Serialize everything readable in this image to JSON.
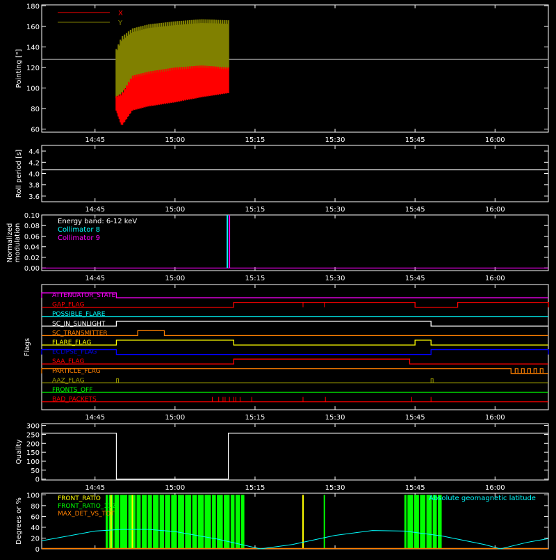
{
  "colors": {
    "background": "#000000",
    "axis": "#ffffff",
    "red": "#ff0000",
    "olive": "#808000",
    "cyan": "#00ffff",
    "magenta": "#ff00ff",
    "orange": "#ff8000",
    "yellow": "#ffff00",
    "blue": "#0000ff",
    "green": "#00ff00",
    "olive_flag": "#9a9a00"
  },
  "time_axis": {
    "start": "14:35",
    "end": "16:10",
    "ticks": [
      "14:45",
      "15:00",
      "15:15",
      "15:30",
      "15:45",
      "16:00"
    ]
  },
  "chart_data": [
    {
      "id": "pointing",
      "type": "line",
      "ylabel": "Pointing [\"]",
      "ylim": [
        57,
        181
      ],
      "yticks": [
        "60",
        "80",
        "100",
        "120",
        "140",
        "160",
        "180"
      ],
      "xlim": [
        "14:35",
        "16:10"
      ],
      "legend": [
        "X",
        "Y"
      ],
      "legend_position": "top-left",
      "reference_line": 128,
      "series": [
        {
          "name": "X",
          "color_key": "red",
          "band": [
            {
              "t": "14:49",
              "low": 78,
              "high": 92
            },
            {
              "t": "14:50",
              "low": 63,
              "high": 95
            },
            {
              "t": "14:52",
              "low": 78,
              "high": 112
            },
            {
              "t": "14:55",
              "low": 82,
              "high": 116
            },
            {
              "t": "15:00",
              "low": 86,
              "high": 120
            },
            {
              "t": "15:05",
              "low": 91,
              "high": 122
            },
            {
              "t": "15:10",
              "low": 95,
              "high": 120
            }
          ]
        },
        {
          "name": "Y",
          "color_key": "olive",
          "band": [
            {
              "t": "14:49",
              "low": 90,
              "high": 138
            },
            {
              "t": "14:50",
              "low": 95,
              "high": 150
            },
            {
              "t": "14:52",
              "low": 105,
              "high": 158
            },
            {
              "t": "14:55",
              "low": 110,
              "high": 162
            },
            {
              "t": "15:00",
              "low": 112,
              "high": 165
            },
            {
              "t": "15:05",
              "low": 115,
              "high": 167
            },
            {
              "t": "15:10",
              "low": 117,
              "high": 166
            }
          ]
        }
      ]
    },
    {
      "id": "roll_period",
      "type": "line",
      "ylabel": "Roll period [s]",
      "ylim": [
        3.5,
        4.5
      ],
      "yticks": [
        "3.6",
        "3.8",
        "4.0",
        "4.2",
        "4.4"
      ],
      "xlim": [
        "14:35",
        "16:10"
      ],
      "series": [
        {
          "color_key": "axis",
          "points": [
            {
              "t": "14:35",
              "v": 4.07
            },
            {
              "t": "16:10",
              "v": 4.07
            }
          ]
        }
      ]
    },
    {
      "id": "modulation",
      "type": "line",
      "ylabel": "Normalized modulation",
      "ylim": [
        -0.005,
        0.1
      ],
      "yticks": [
        "0.00",
        "0.02",
        "0.04",
        "0.06",
        "0.08",
        "0.10"
      ],
      "xlim": [
        "14:35",
        "16:10"
      ],
      "annotation": "Energy band: 6-12 keV",
      "legend": [
        "Collimator 8",
        "Collimator 9"
      ],
      "series": [
        {
          "name": "Collimator 8",
          "color_key": "cyan",
          "spike": "15:10"
        },
        {
          "name": "Collimator 9",
          "color_key": "magenta",
          "spike": "15:10"
        }
      ]
    },
    {
      "id": "flags",
      "type": "line",
      "ylabel": "Flags",
      "xlim": [
        "14:35",
        "16:10"
      ],
      "series": [
        {
          "name": "ATTENUATOR_STATE",
          "color_key": "magenta",
          "high": [
            [
              "14:35",
              "14:49"
            ]
          ]
        },
        {
          "name": "GAP_FLAG",
          "color_key": "red",
          "high": [
            [
              "15:11",
              "15:45"
            ],
            [
              "15:53",
              "16:10"
            ]
          ]
        },
        {
          "name": "POSSIBLE_FLARE",
          "color_key": "cyan",
          "high": []
        },
        {
          "name": "SC_IN_SUNLIGHT",
          "color_key": "axis",
          "high": [
            [
              "14:49",
              "15:48"
            ]
          ]
        },
        {
          "name": "SC_TRANSMITTER",
          "color_key": "orange",
          "high": [
            [
              "14:53",
              "14:58"
            ]
          ]
        },
        {
          "name": "FLARE_FLAG",
          "color_key": "yellow",
          "high": [
            [
              "14:49",
              "15:11"
            ],
            [
              "15:45",
              "15:48"
            ]
          ]
        },
        {
          "name": "ECLIPSE_FLAG",
          "color_key": "blue",
          "high": [
            [
              "14:35",
              "14:49"
            ],
            [
              "15:48",
              "16:10"
            ]
          ]
        },
        {
          "name": "SAA_FLAG",
          "color_key": "red",
          "high": [
            [
              "15:11",
              "15:44"
            ]
          ]
        },
        {
          "name": "PARTICLE_FLAG",
          "color_key": "orange",
          "high": [
            [
              "14:35",
              "16:03"
            ]
          ]
        },
        {
          "name": "AAZ_FLAG",
          "color_key": "olive_flag",
          "high": []
        },
        {
          "name": "FRONTS_OFF",
          "color_key": "green",
          "high": []
        },
        {
          "name": "BAD_PACKETS",
          "color_key": "red",
          "high": []
        }
      ]
    },
    {
      "id": "quality",
      "type": "line",
      "ylabel": "Quality",
      "ylim": [
        -5,
        310
      ],
      "yticks": [
        "0",
        "50",
        "100",
        "150",
        "200",
        "250",
        "300"
      ],
      "xlim": [
        "14:35",
        "16:10"
      ],
      "series": [
        {
          "color_key": "axis",
          "points": [
            {
              "t": "14:35",
              "v": 257
            },
            {
              "t": "14:49",
              "v": 257
            },
            {
              "t": "14:49",
              "v": 0
            },
            {
              "t": "15:10",
              "v": 0
            },
            {
              "t": "15:10",
              "v": 257
            },
            {
              "t": "16:10",
              "v": 257
            }
          ]
        }
      ]
    },
    {
      "id": "geomagnetic",
      "type": "line",
      "ylabel": "Degrees or %",
      "ylim": [
        0,
        103
      ],
      "yticks": [
        "0",
        "20",
        "40",
        "60",
        "80",
        "100"
      ],
      "xlim": [
        "14:35",
        "16:10"
      ],
      "legend": [
        "FRONT_RATIO",
        "FRONT_RATIO_1125",
        "MAX_DET_VS_TOT"
      ],
      "annotation": "Absolute geomagnetic latitude",
      "series": [
        {
          "name": "Absolute geomagnetic latitude",
          "color_key": "cyan",
          "points": [
            {
              "t": "14:35",
              "v": 15
            },
            {
              "t": "14:45",
              "v": 33
            },
            {
              "t": "14:50",
              "v": 36
            },
            {
              "t": "14:55",
              "v": 36
            },
            {
              "t": "15:00",
              "v": 32
            },
            {
              "t": "15:08",
              "v": 18
            },
            {
              "t": "15:16",
              "v": 0
            },
            {
              "t": "15:22",
              "v": 8
            },
            {
              "t": "15:30",
              "v": 25
            },
            {
              "t": "15:37",
              "v": 34
            },
            {
              "t": "15:43",
              "v": 33
            },
            {
              "t": "15:50",
              "v": 24
            },
            {
              "t": "15:58",
              "v": 8
            },
            {
              "t": "16:01",
              "v": 0
            },
            {
              "t": "16:06",
              "v": 12
            },
            {
              "t": "16:10",
              "v": 19
            }
          ]
        },
        {
          "name": "FRONT_RATIO",
          "color_key": "yellow",
          "pulses": [
            "14:48",
            "14:52",
            "15:24"
          ]
        },
        {
          "name": "FRONT_RATIO_1125",
          "color_key": "green",
          "bands": [
            [
              "14:47",
              "15:13"
            ],
            [
              "15:43",
              "15:50"
            ]
          ],
          "pulses": [
            "15:28"
          ]
        },
        {
          "name": "MAX_DET_VS_TOT",
          "color_key": "orange",
          "baseline": 0
        }
      ]
    }
  ]
}
